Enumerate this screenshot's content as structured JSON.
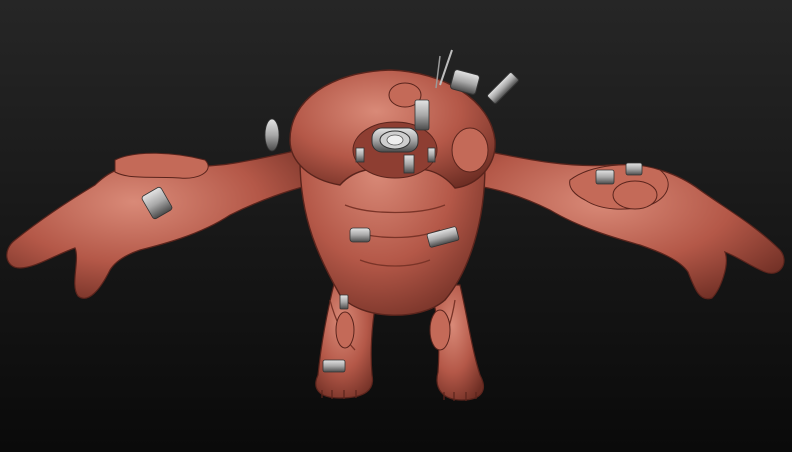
{
  "scene": {
    "subject": "creature-sculpt",
    "colors": {
      "background_top": "#262626",
      "background_bottom": "#0a0a0a",
      "clay_base": "#b45848",
      "clay_light": "#d98a78",
      "clay_dark": "#6e2e24",
      "metal": "#a9a9a9",
      "metal_dark": "#4a4a4a"
    }
  }
}
